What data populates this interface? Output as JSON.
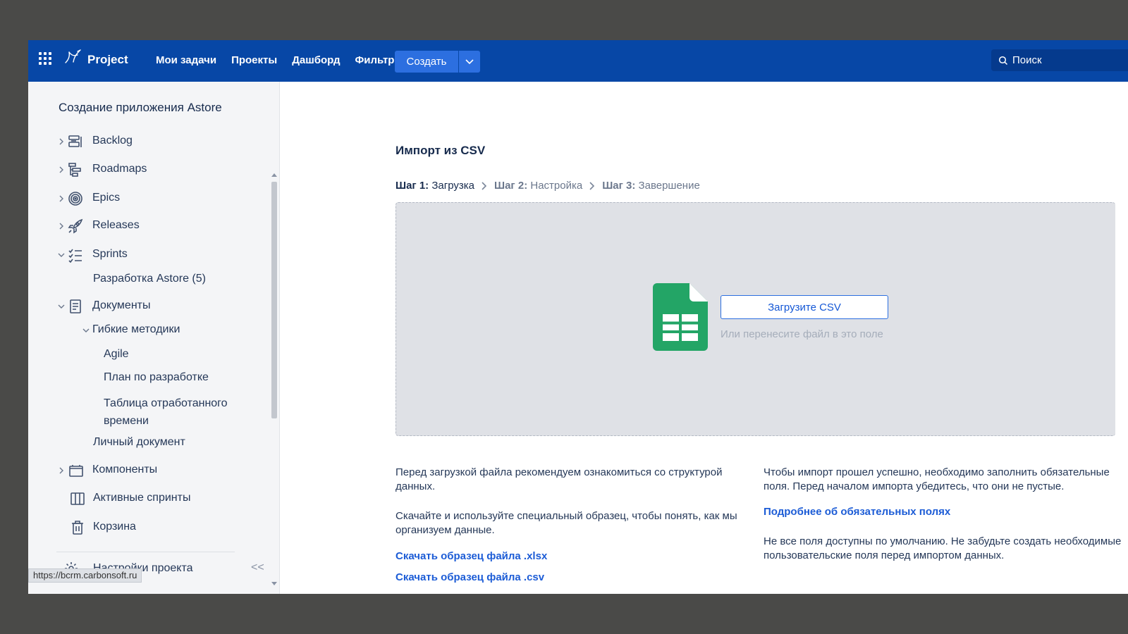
{
  "header": {
    "brand": "Project",
    "nav": [
      "Мои задачи",
      "Проекты",
      "Дашборд",
      "Фильтры"
    ],
    "create_label": "Создать",
    "search_placeholder": "Поиск"
  },
  "sidebar": {
    "project_title": "Создание приложения Astore",
    "items": [
      {
        "label": "Backlog",
        "icon": "backlog-icon"
      },
      {
        "label": "Roadmaps",
        "icon": "roadmap-icon"
      },
      {
        "label": "Epics",
        "icon": "target-icon"
      },
      {
        "label": "Releases",
        "icon": "rocket-icon"
      },
      {
        "label": "Sprints",
        "icon": "checklist-icon"
      },
      {
        "label": "Разработка Astore (5)"
      },
      {
        "label": "Документы",
        "icon": "document-icon"
      },
      {
        "label": "Гибкие методики"
      },
      {
        "label": "Agile"
      },
      {
        "label": "План по разработке"
      },
      {
        "label": "Таблица отработанного",
        "label2": "времени"
      },
      {
        "label": "Личный документ"
      },
      {
        "label": "Компоненты",
        "icon": "folder-icon"
      },
      {
        "label": "Активные спринты",
        "icon": "board-icon"
      },
      {
        "label": "Корзина",
        "icon": "trash-icon"
      }
    ],
    "settings_label": "Настройки проекта",
    "collapse_glyph": "<<",
    "url_tooltip": "https://bcrm.carbonsoft.ru"
  },
  "main": {
    "title": "Импорт из CSV",
    "steps": [
      {
        "num": "Шаг 1:",
        "name": "Загрузка"
      },
      {
        "num": "Шаг 2:",
        "name": "Настройка"
      },
      {
        "num": "Шаг 3:",
        "name": "Завершение"
      }
    ],
    "upload_label": "Загрузите CSV",
    "drop_hint": "Или перенесите файл в это поле",
    "left": {
      "p1": "Перед загрузкой файла рекомендуем ознакомиться со структурой данных.",
      "p2": "Скачайте и используйте специальный образец, чтобы понять, как мы организуем данные.",
      "link1": "Скачать образец файла .xlsx",
      "link2": "Скачать образец файла .csv"
    },
    "right": {
      "p1": "Чтобы импорт прошел успешно, необходимо заполнить обязательные поля. Перед началом импорта убедитесь, что они не пустые.",
      "link": "Подробнее об обязательных полях",
      "p2a": "Не все поля доступны по умолчанию. Не забудьте создать необходимые",
      "p2b": "пользовательские поля перед импортом данных."
    }
  },
  "colors": {
    "header": "#0747a6",
    "accent": "#2c6fe0",
    "csv_green": "#23a566"
  }
}
